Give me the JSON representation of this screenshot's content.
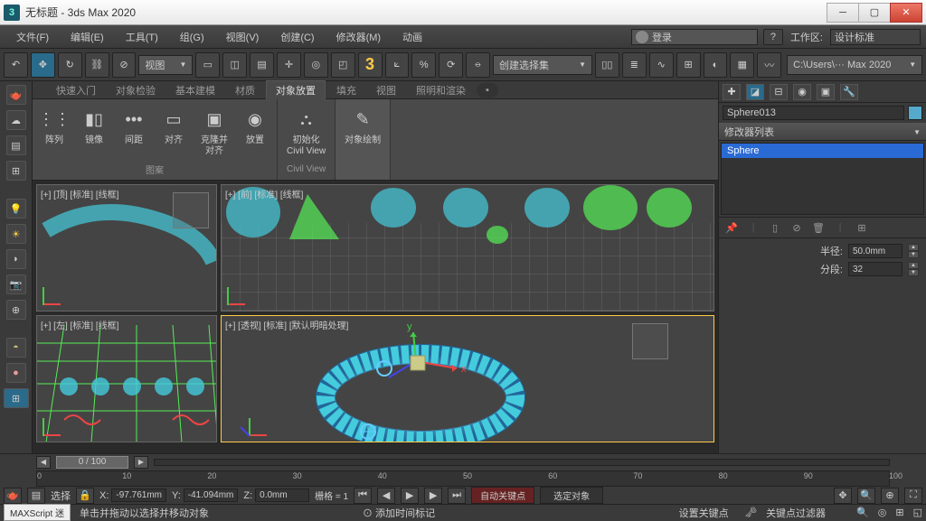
{
  "title": "无标题 - 3ds Max 2020",
  "menus": [
    "文件(F)",
    "编辑(E)",
    "工具(T)",
    "组(G)",
    "视图(V)",
    "创建(C)",
    "修改器(M)",
    "动画"
  ],
  "login": "登录",
  "workspace_label": "工作区:",
  "workspace_value": "设计标准",
  "toolbar": {
    "view_drop": "视图",
    "selset_drop": "创建选择集",
    "path": "C:\\Users\\··· Max 2020"
  },
  "ribtabs": [
    "快速入门",
    "对象检验",
    "基本建模",
    "材质",
    "对象放置",
    "填充",
    "视图",
    "照明和渲染"
  ],
  "ribbon": {
    "group1": {
      "name": "图案",
      "items": [
        {
          "l": "阵列",
          "i": "⋮⋮"
        },
        {
          "l": "镜像",
          "i": "▮▯"
        },
        {
          "l": "间距",
          "i": "•••"
        },
        {
          "l": "对齐",
          "i": "▭"
        },
        {
          "l": "克隆并\n对齐",
          "i": "▣"
        },
        {
          "l": "放置",
          "i": "◉"
        }
      ]
    },
    "group2": {
      "name": "Civil View",
      "items": [
        {
          "l": "初始化\nCivil View",
          "i": "⛬"
        }
      ]
    },
    "group3": {
      "name": "",
      "items": [
        {
          "l": "对象绘制",
          "i": "✎"
        }
      ]
    }
  },
  "viewports": {
    "tl": "[+] [顶] [标准] [线框]",
    "tr": "[+] [前] [标准] [线框]",
    "bl": "[+] [左] [标准] [线框]",
    "br": "[+] [透视] [标准] [默认明暗处理]"
  },
  "object_name": "Sphere013",
  "modlist_header": "修改器列表",
  "modlist_item": "Sphere",
  "params": {
    "radius_l": "半径:",
    "radius_v": "50.0mm",
    "seg_l": "分段:",
    "seg_v": "32"
  },
  "time": {
    "frame": "0 / 100",
    "ticks": [
      "0",
      "10",
      "20",
      "30",
      "40",
      "50",
      "60",
      "70",
      "80",
      "90",
      "100"
    ]
  },
  "status": {
    "sel": "选择",
    "x": "X:",
    "xv": "-97.761mm",
    "y": "Y:",
    "yv": "-41.094mm",
    "z": "Z:",
    "zv": "0.0mm",
    "grid": "栅格 = 1",
    "autokey": "自动关键点",
    "selobj": "选定对象",
    "setkey": "设置关键点",
    "keyfilter": "关键点过滤器"
  },
  "hint": {
    "maxscript": "MAXScript 迷",
    "msg": "单击并拖动以选择并移动对象",
    "addtime": "添加时间标记"
  }
}
